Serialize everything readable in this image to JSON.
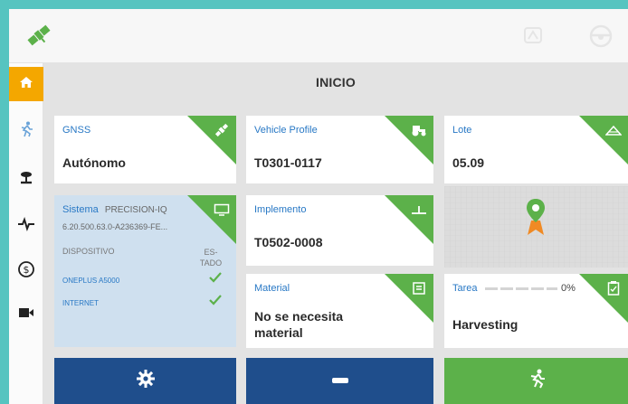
{
  "app": {
    "page_title": "INICIO",
    "topbar": {
      "satellite_icon": "satellite-icon",
      "right_icons": [
        "steering-icon",
        "steering-wheel-icon"
      ]
    },
    "sidebar": {
      "items": [
        {
          "icon": "home-icon",
          "active": true
        },
        {
          "icon": "guidance-runner-icon",
          "active": false
        },
        {
          "icon": "gps-antenna-icon",
          "active": false
        },
        {
          "icon": "pulse-icon",
          "active": false
        },
        {
          "icon": "dollar-icon",
          "active": false
        },
        {
          "icon": "camera-icon",
          "active": false
        }
      ]
    },
    "cards": {
      "gnss": {
        "label": "GNSS",
        "value": "Autónomo",
        "icon": "satellite-icon"
      },
      "vehicle_profile": {
        "label": "Vehicle Profile",
        "value": "T0301-0117",
        "icon": "tractor-icon"
      },
      "lote": {
        "label": "Lote",
        "value": "05.09",
        "icon": "field-icon"
      },
      "sistema": {
        "label": "Sistema",
        "brand": "PRECISION-IQ",
        "version": "6.20.500.63.0-A236369-FE...",
        "col_device": "DISPOSITIVO",
        "col_status_1": "ES-",
        "col_status_2": "TADO",
        "rows": [
          {
            "name": "ONEPLUS A5000",
            "ok": true
          },
          {
            "name": "INTERNET",
            "ok": true
          }
        ],
        "icon": "monitor-icon"
      },
      "implemento": {
        "label": "Implemento",
        "value": "T0502-0008",
        "icon": "implement-icon"
      },
      "material": {
        "label": "Material",
        "value_1": "No se necesita",
        "value_2": "material",
        "icon": "material-icon"
      },
      "tarea": {
        "label": "Tarea",
        "progress_text": "0%",
        "progress": 0,
        "value": "Harvesting",
        "icon": "clipboard-icon"
      }
    },
    "bottom_buttons": [
      {
        "icon": "gear-icon",
        "color": "#1f4e8c"
      },
      {
        "icon": "minus-icon",
        "color": "#1f4e8c"
      },
      {
        "icon": "runner-icon",
        "color": "#5cb14a"
      }
    ],
    "colors": {
      "accent": "#5cb14a",
      "navy": "#1f4e8c",
      "active_tab": "#f4a700",
      "label_blue": "#2878c5",
      "frame": "#56c4c0"
    }
  }
}
